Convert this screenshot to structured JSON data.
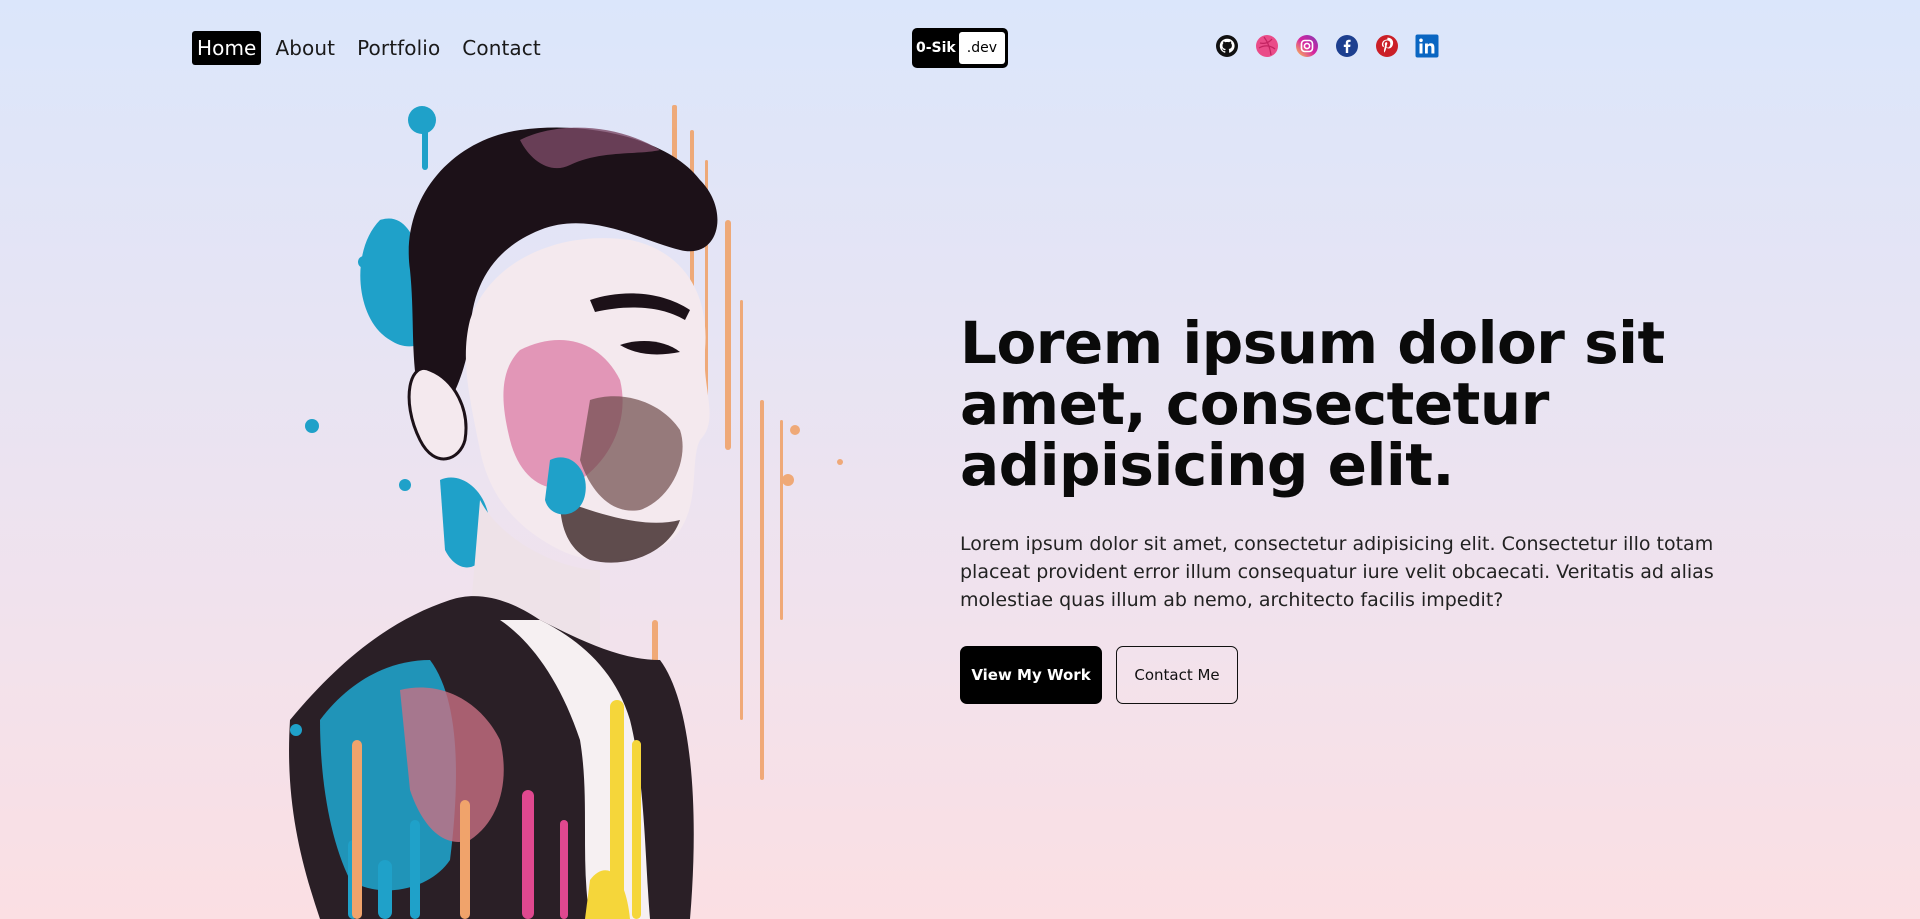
{
  "nav": {
    "items": [
      {
        "label": "Home",
        "active": true
      },
      {
        "label": "About",
        "active": false
      },
      {
        "label": "Portfolio",
        "active": false
      },
      {
        "label": "Contact",
        "active": false
      }
    ]
  },
  "logo": {
    "left_text": "0-Sik",
    "right_text": ".dev"
  },
  "socials": [
    {
      "name": "github-icon"
    },
    {
      "name": "dribbble-icon"
    },
    {
      "name": "instagram-icon"
    },
    {
      "name": "facebook-icon"
    },
    {
      "name": "pinterest-icon"
    },
    {
      "name": "linkedin-icon"
    }
  ],
  "hero": {
    "headline": "Lorem ipsum dolor sit amet, consectetur adipisicing elit.",
    "lead": "Lorem ipsum dolor sit amet, consectetur adipisicing elit. Consectetur illo totam placeat provident error illum consequatur iure velit obcaecati. Veritatis ad alias molestiae quas illum ab nemo, architecto facilis impedit?",
    "primary_cta": "View My Work",
    "secondary_cta": "Contact Me"
  },
  "colors": {
    "accent": "#000000",
    "bg_top": "#dbe6fb",
    "bg_bottom": "#fbdfe3",
    "dribbble": "#ea4c89",
    "instagram": "#d6249f",
    "facebook": "#1877f2",
    "pinterest": "#e60023",
    "linkedin": "#0a66c2"
  }
}
